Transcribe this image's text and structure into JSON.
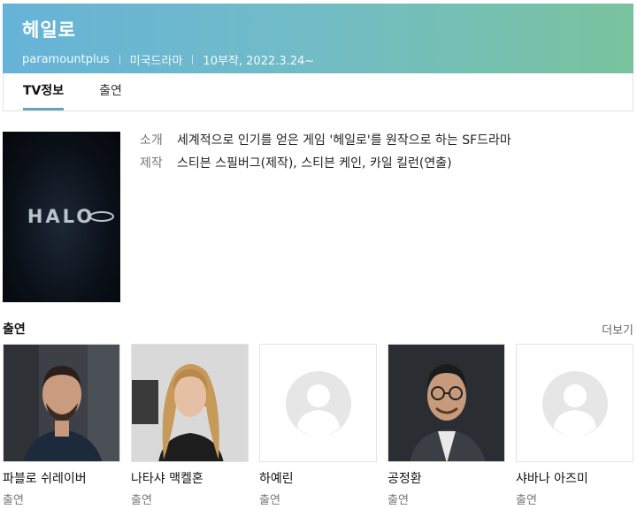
{
  "program": {
    "title": "헤일로",
    "channel": "paramountplus",
    "genre": "미국드라마",
    "episodes": "10부작, 2022.3.24~"
  },
  "tabs": [
    {
      "label": "TV정보",
      "active": true
    },
    {
      "label": "출연",
      "active": false
    }
  ],
  "poster": {
    "logo_text": "HALO"
  },
  "info": {
    "intro_label": "소개",
    "intro_value": "세계적으로 인기를 얻은 게임 '헤일로'를 원작으로 하는 SF드라마",
    "production_label": "제작",
    "production_value": "스티븐 스필버그(제작), 스티븐 케인, 카일 킬런(연출)"
  },
  "cast": {
    "heading": "출연",
    "more_label": "더보기",
    "members": [
      {
        "name": "파블로 쉬레이버",
        "role": "출연",
        "photo": "person-photo"
      },
      {
        "name": "나타샤 맥켈혼",
        "role": "출연",
        "photo": "person-photo"
      },
      {
        "name": "하예린",
        "role": "출연",
        "photo": "placeholder-avatar-icon"
      },
      {
        "name": "공정환",
        "role": "출연",
        "photo": "person-photo"
      },
      {
        "name": "샤바나 아즈미",
        "role": "출연",
        "photo": "placeholder-avatar-icon"
      }
    ]
  },
  "colors": {
    "header_left": "#66b3d8",
    "header_right": "#79c39e",
    "tab_underline": "#6aa2bb"
  }
}
